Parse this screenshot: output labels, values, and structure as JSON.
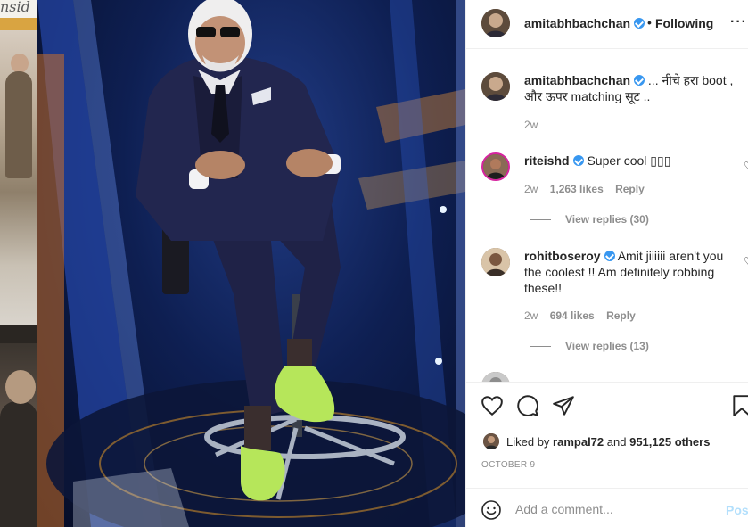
{
  "backdrop": {
    "partial_text": "nsid"
  },
  "post_author": {
    "username": "amitabhbachchan",
    "separator": "•",
    "follow_status": "Following",
    "more_icon": "more-horizontal-icon"
  },
  "caption": {
    "username": "amitabhbachchan",
    "text_line1": "... नीचे हरा boot ,",
    "text_line2": "और ऊपर matching सूट ..",
    "time": "2w"
  },
  "comments": [
    {
      "username": "riteishd",
      "text": "Super cool ",
      "time": "2w",
      "likes": "1,263 likes",
      "reply": "Reply",
      "view_replies": "View replies (30)"
    },
    {
      "username": "rohitboseroy",
      "text_line1": "Amit jiiiiii aren't you",
      "text_line2": "the coolest !! Am definitely robbing",
      "text_line3": "these!!",
      "time": "2w",
      "likes": "694 likes",
      "reply": "Reply",
      "view_replies": "View replies (13)"
    }
  ],
  "actions": {
    "like_icon": "heart-icon",
    "comment_icon": "comment-icon",
    "share_icon": "share-icon",
    "save_icon": "bookmark-icon"
  },
  "likes_summary": {
    "prefix": "Liked by",
    "user": "rampal72",
    "middle": "and",
    "others": "951,125 others"
  },
  "post_date": "OCTOBER 9",
  "comment_box": {
    "placeholder": "Add a comment...",
    "post_label": "Post"
  },
  "colors": {
    "verified": "#3897f0",
    "post_button": "#b2dffc",
    "text": "#262626",
    "secondary": "#8e8e8e",
    "sneaker": "#b6e65a"
  }
}
